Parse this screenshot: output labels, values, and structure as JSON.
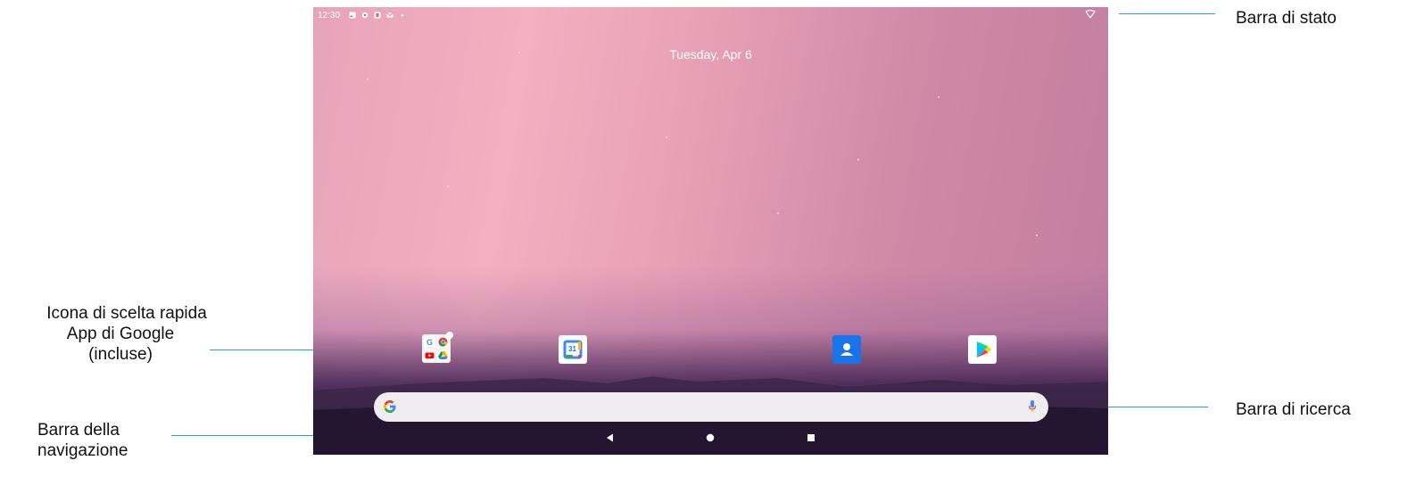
{
  "callouts": {
    "status_bar": "Barra di stato",
    "google_apps_line1": "Icona di scelta rapida",
    "google_apps_line2": "App di Google",
    "google_apps_line3": "(incluse)",
    "nav_bar_line1": "Barra della",
    "nav_bar_line2": "navigazione",
    "search_bar": "Barra di ricerca"
  },
  "screen": {
    "status_bar": {
      "time": "12:30",
      "notification_icons": [
        "image-icon",
        "gear-icon",
        "app-icon",
        "mail-icon",
        "dot-icon"
      ],
      "wifi_icon": "wifi-icon"
    },
    "date": "Tuesday, Apr 6",
    "dock_apps": [
      "google-apps-folder",
      "calendar-app",
      "contacts-app",
      "play-store-app"
    ],
    "calendar_day": "31",
    "search": {
      "logo": "google-g-icon",
      "mic": "mic-icon"
    },
    "nav_buttons": [
      "back-icon",
      "home-icon",
      "recents-icon"
    ]
  },
  "colors": {
    "callout_line": "#1ea0e0",
    "contacts_bg": "#1a73e8",
    "search_bg": "#eeecef"
  }
}
